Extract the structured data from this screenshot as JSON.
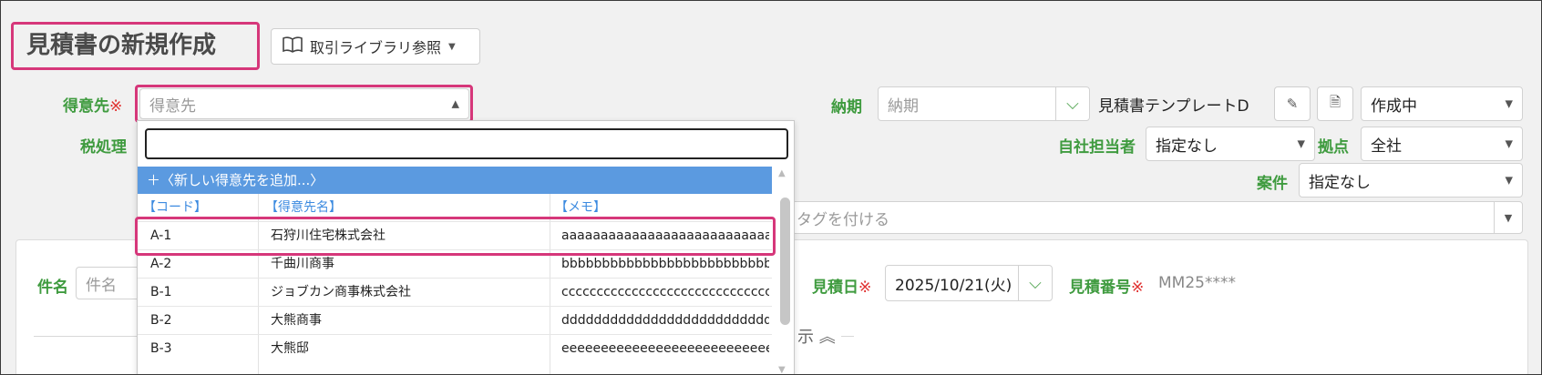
{
  "page": {
    "title": "見積書の新規作成"
  },
  "header": {
    "library_button": "取引ライブラリ参照"
  },
  "form": {
    "required_mark": "※",
    "customer": {
      "label": "得意先",
      "placeholder": "得意先"
    },
    "delivery": {
      "label": "納期",
      "placeholder": "納期"
    },
    "template_name": "見積書テンプレートD",
    "status": "作成中",
    "tax_label": "税処理",
    "staff": {
      "label": "自社担当者",
      "value": "指定なし"
    },
    "branch": {
      "label": "拠点",
      "value": "全社"
    },
    "project": {
      "label": "案件",
      "value": "指定なし"
    },
    "tag_placeholder": "タグを付ける",
    "subject": {
      "label": "件名",
      "placeholder": "件名"
    },
    "estimate_date": {
      "label": "見積日",
      "value": "2025/10/21(火)"
    },
    "estimate_number": {
      "label": "見積番号",
      "value": "MM25****"
    }
  },
  "panel": {
    "collapse_tail": "示"
  },
  "dropdown": {
    "add_new": "＋〈新しい得意先を追加...〉",
    "columns": [
      "【コード】",
      "【得意先名】",
      "【メモ】"
    ],
    "rows": [
      {
        "code": "A-1",
        "name": "石狩川住宅株式会社",
        "memo": "aaaaaaaaaaaaaaaaaaaaaaaaaaaa..."
      },
      {
        "code": "A-2",
        "name": "千曲川商事",
        "memo": "bbbbbbbbbbbbbbbbbbbbbbbbbbb..."
      },
      {
        "code": "B-1",
        "name": "ジョブカン商事株式会社",
        "memo": "ccccccccccccccccccccccccccccccc"
      },
      {
        "code": "B-2",
        "name": "大熊商事",
        "memo": "dddddddddddddddddddddddddd..."
      },
      {
        "code": "B-3",
        "name": "大熊邸",
        "memo": "eeeeeeeeeeeeeeeeeeeeeeeeeeeee..."
      }
    ]
  }
}
